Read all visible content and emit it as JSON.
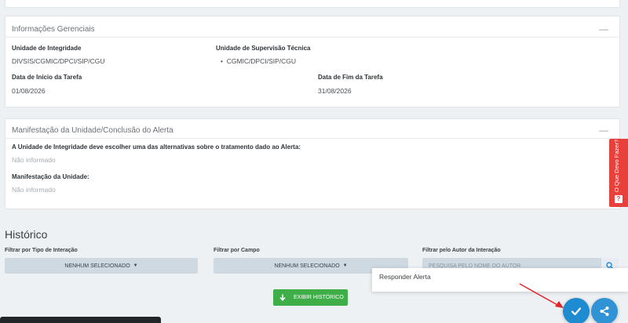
{
  "info_panel": {
    "title": "Informações Gerenciais",
    "collapse_glyph": "—",
    "unidade_integridade_label": "Unidade de Integridade",
    "unidade_integridade_value": "DIVSIS/CGMIC/DPCI/SIP/CGU",
    "unidade_supervisao_label": "Unidade de Supervisão Técnica",
    "unidade_supervisao_items": [
      "CGMIC/DPCI/SIP/CGU"
    ],
    "data_inicio_label": "Data de Início da Tarefa",
    "data_inicio_value": "01/08/2026",
    "data_fim_label": "Data de Fim da Tarefa",
    "data_fim_value": "31/08/2026"
  },
  "manifest_panel": {
    "title": "Manifestação da Unidade/Conclusão do Alerta",
    "collapse_glyph": "—",
    "question_label": "A Unidade de Integridade deve escolher uma das alternativas sobre o tratamento dado ao Alerta:",
    "question_value": "Não informado",
    "manifestacao_label": "Manifestação da Unidade:",
    "manifestacao_value": "Não informado"
  },
  "historico": {
    "title": "Histórico",
    "filter_tipo_label": "Filtrar por Tipo de Interação",
    "filter_tipo_value": "NENHUM SELECIONADO",
    "filter_campo_label": "Filtrar por Campo",
    "filter_campo_value": "NENHUM SELECIONADO",
    "filter_autor_label": "Filtrar pelo Autor da Interação",
    "filter_autor_placeholder": "PESQUISA PELO NOME DO AUTOR",
    "exibir_button": "EXIBIR HISTÓRICO"
  },
  "popup": {
    "label": "Responder Alerta"
  },
  "side_tab": {
    "label": "O Que Devo Fazer?",
    "icon_glyph": "?"
  },
  "colors": {
    "accent_blue": "#1f8bd0",
    "success_green": "#3fae49",
    "help_red": "#e8413c",
    "filter_bg": "#cfd9e1"
  },
  "icons": {
    "collapse": "minus-icon",
    "search": "search-icon",
    "download": "arrow-down-icon",
    "check": "check-icon",
    "share": "share-icon",
    "help": "question-icon"
  }
}
